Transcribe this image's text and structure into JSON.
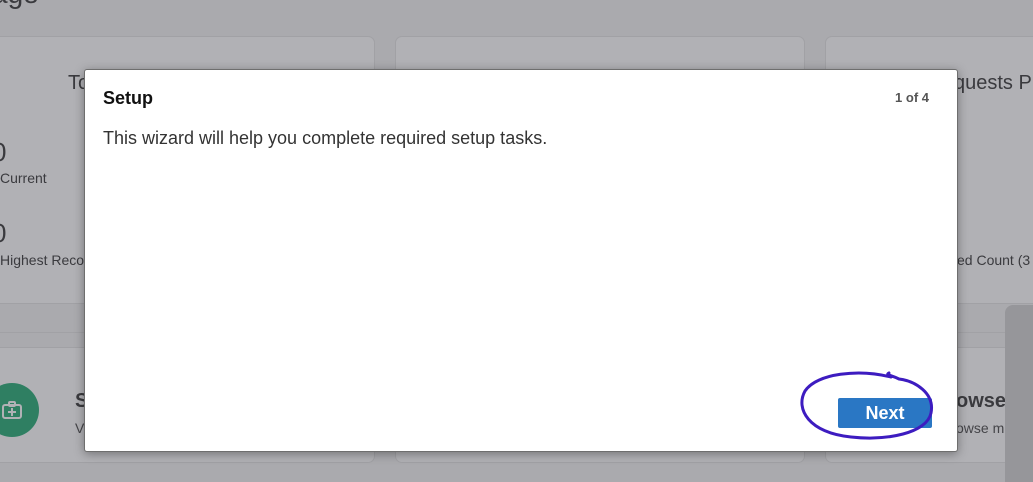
{
  "background": {
    "page_title": "age",
    "cards": [
      {
        "title": "To"
      },
      {
        "title": ""
      },
      {
        "title": "quests P"
      }
    ],
    "stats_left": [
      {
        "value": "0",
        "label": "Current"
      },
      {
        "value": "0",
        "label": "Highest Reco"
      }
    ],
    "stats_right": [
      {
        "label": "ed Count (3"
      }
    ],
    "tiles": [
      {
        "title": "S",
        "subtitle": "V"
      },
      {
        "title": "owse",
        "subtitle": "owse m"
      }
    ]
  },
  "modal": {
    "title": "Setup",
    "step": "1 of 4",
    "body": "This wizard will help you complete required setup tasks.",
    "next_label": "Next"
  },
  "colors": {
    "primary_button": "#2a77c4",
    "highlight": "#3d1cc0",
    "tile_icon": "#1fa971"
  }
}
